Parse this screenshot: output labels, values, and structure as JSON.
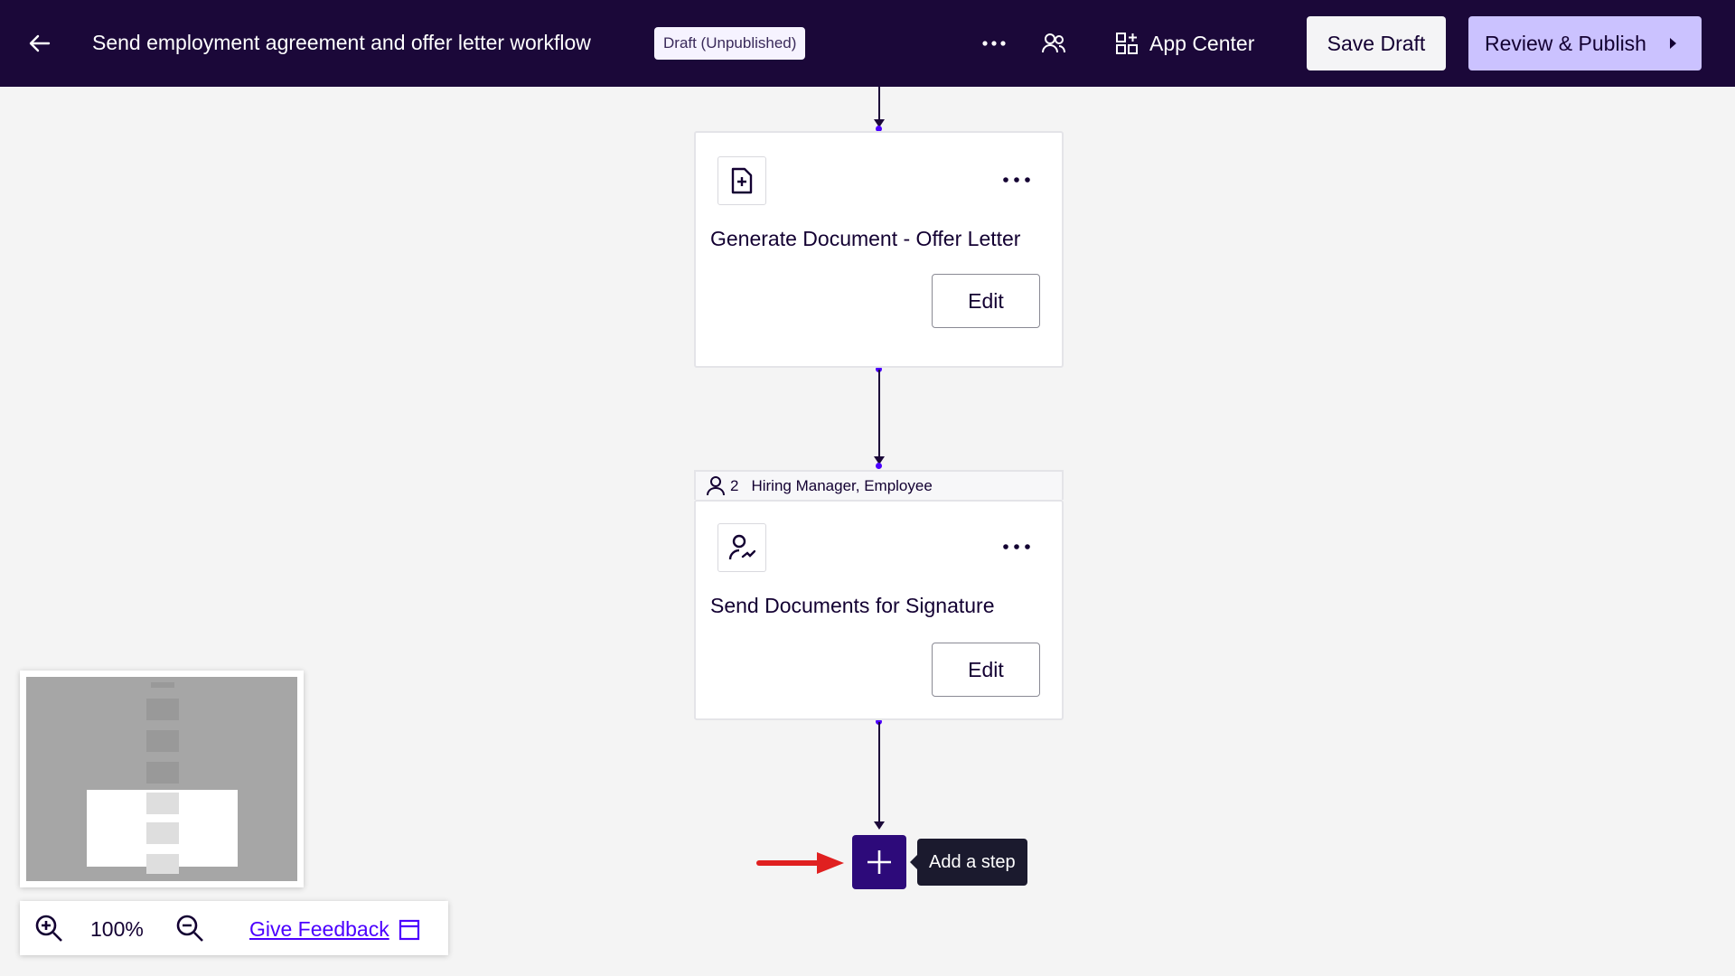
{
  "header": {
    "title": "Send employment agreement and offer letter workflow",
    "status_badge": "Draft (Unpublished)",
    "app_center_label": "App Center",
    "save_draft_label": "Save Draft",
    "review_publish_label": "Review & Publish"
  },
  "steps": [
    {
      "title": "Generate Document - Offer Letter",
      "icon": "document-add-icon",
      "edit_label": "Edit"
    },
    {
      "title": "Send Documents for Signature",
      "icon": "person-sign-icon",
      "edit_label": "Edit",
      "assignees": {
        "count": "2",
        "names": "Hiring Manager, Employee"
      }
    }
  ],
  "add_step": {
    "tooltip": "Add a step"
  },
  "zoom": {
    "level": "100%",
    "feedback_label": "Give Feedback"
  },
  "colors": {
    "header_bg": "#1b0839",
    "accent": "#4c00ff",
    "publish_button": "#cbc2ff",
    "add_step_button": "#2d0a7a",
    "annotation_arrow": "#e02020"
  }
}
